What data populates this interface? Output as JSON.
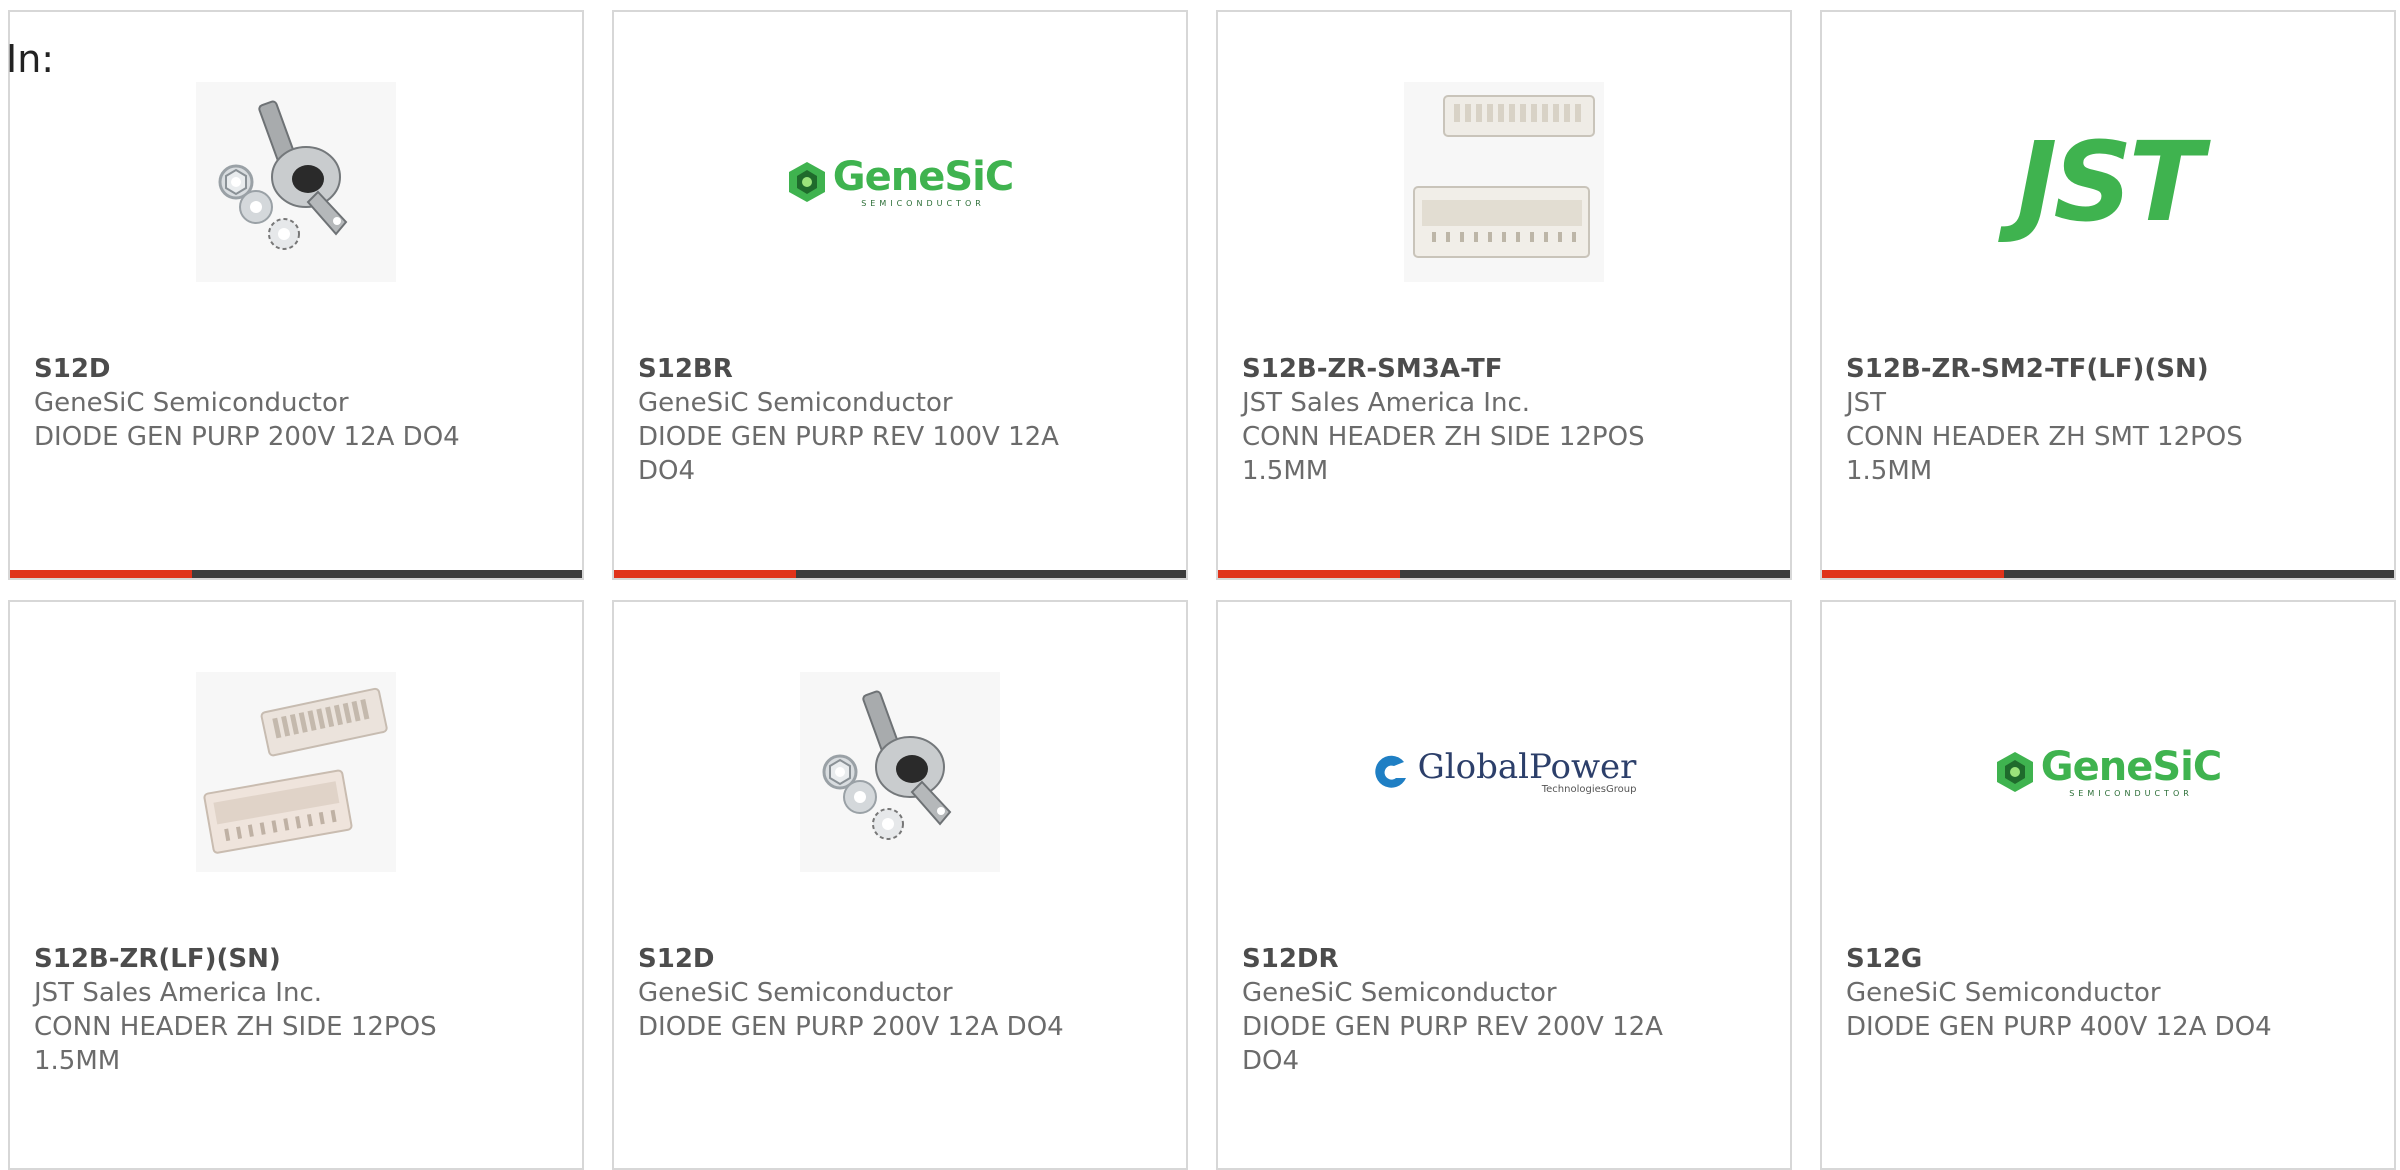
{
  "header": {
    "in_label": "In:"
  },
  "cards": [
    {
      "part_number": "S12D",
      "manufacturer": "GeneSiC Semiconductor",
      "description": "DIODE GEN PURP 200V 12A DO4",
      "image": "diode-stud-image"
    },
    {
      "part_number": "S12BR",
      "manufacturer": "GeneSiC Semiconductor",
      "description": "DIODE GEN PURP REV 100V 12A DO4",
      "image": "genesic-logo",
      "logo_text": "GeneSiC",
      "logo_sub": "SEMICONDUCTOR"
    },
    {
      "part_number": "S12B-ZR-SM3A-TF",
      "manufacturer": "JST Sales America Inc.",
      "description": "CONN HEADER ZH SIDE 12POS 1.5MM",
      "image": "connector-header-image"
    },
    {
      "part_number": "S12B-ZR-SM2-TF(LF)(SN)",
      "manufacturer": "JST",
      "description": "CONN HEADER ZH SMT 12POS 1.5MM",
      "image": "jst-logo",
      "logo_text": "JST"
    },
    {
      "part_number": "S12B-ZR(LF)(SN)",
      "manufacturer": "JST Sales America Inc.",
      "description": "CONN HEADER ZH SIDE 12POS 1.5MM",
      "image": "connector-header-image"
    },
    {
      "part_number": "S12D",
      "manufacturer": "GeneSiC Semiconductor",
      "description": "DIODE GEN PURP 200V 12A DO4",
      "image": "diode-stud-image"
    },
    {
      "part_number": "S12DR",
      "manufacturer": "GeneSiC Semiconductor",
      "description": "DIODE GEN PURP REV 200V 12A DO4",
      "image": "globalpower-logo",
      "logo_text": "GlobalPower",
      "logo_sub": "TechnologiesGroup"
    },
    {
      "part_number": "S12G",
      "manufacturer": "GeneSiC Semiconductor",
      "description": "DIODE GEN PURP 400V 12A DO4",
      "image": "genesic-logo",
      "logo_text": "GeneSiC",
      "logo_sub": "SEMICONDUCTOR"
    }
  ],
  "colors": {
    "accent": "#e0331b",
    "bar": "#3d3d3d",
    "brand_green": "#3fb34f"
  }
}
